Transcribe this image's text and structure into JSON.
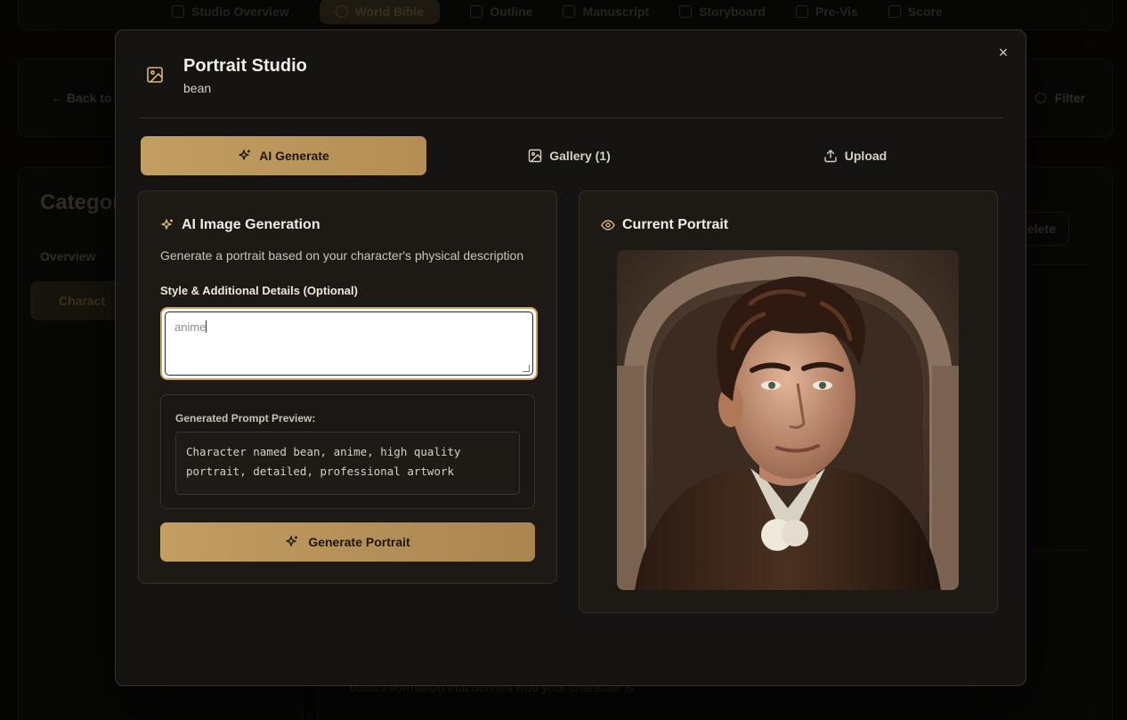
{
  "background": {
    "nav_items": [
      "Studio Overview",
      "World Bible",
      "Outline",
      "Manuscript",
      "Storyboard",
      "Pre-Vis",
      "Score"
    ],
    "back_label": "← Back to D",
    "filter_label": "Filter",
    "category_title": "Categor",
    "overview_label": "Overview",
    "character_label": "Charact",
    "delete_label": "Delete",
    "basic_info_text": "basic information that defines who your character is"
  },
  "modal": {
    "title": "Portrait Studio",
    "subtitle": "bean",
    "close_symbol": "×",
    "tabs": [
      {
        "label": "AI Generate",
        "icon": "sparkles-icon",
        "active": true
      },
      {
        "label": "Gallery (1)",
        "icon": "image-icon",
        "active": false
      },
      {
        "label": "Upload",
        "icon": "upload-icon",
        "active": false
      }
    ]
  },
  "generation": {
    "title": "AI Image Generation",
    "description": "Generate a portrait based on your character's physical description",
    "style_label": "Style & Additional Details (Optional)",
    "style_value": "anime",
    "preview_label": "Generated Prompt Preview:",
    "preview_line1": "Character named bean, anime, high quality",
    "preview_line2": "portrait, detailed, professional artwork",
    "generate_button": "Generate Portrait"
  },
  "current": {
    "title": "Current Portrait",
    "icon": "eye-icon"
  },
  "colors": {
    "accent": "#c29e62",
    "background": "#161412",
    "panel": "#1d1a16"
  }
}
